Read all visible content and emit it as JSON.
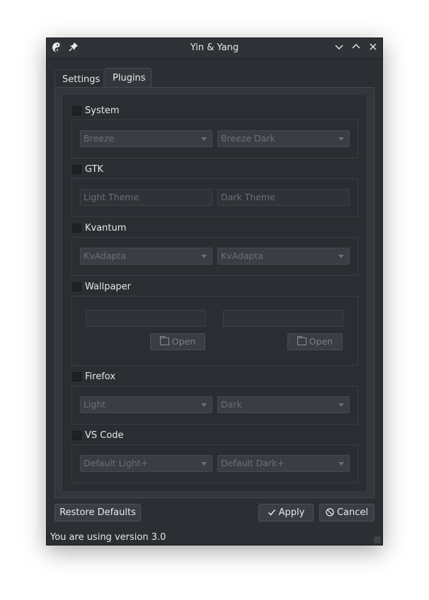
{
  "window": {
    "title": "Yin & Yang"
  },
  "titlebar_icons": {
    "app": "yin-yang-icon",
    "pin": "pin-icon",
    "minimize": "chevron-down-icon",
    "maximize": "chevron-up-icon",
    "close": "close-icon"
  },
  "tabs": [
    {
      "label": "Settings"
    },
    {
      "label": "Plugins"
    }
  ],
  "plugins": {
    "system": {
      "label": "System",
      "light": "Breeze",
      "dark": "Breeze Dark"
    },
    "gtk": {
      "label": "GTK",
      "light_placeholder": "Light Theme",
      "dark_placeholder": "Dark Theme"
    },
    "kvantum": {
      "label": "Kvantum",
      "light": "KvAdapta",
      "dark": "KvAdapta"
    },
    "wallpaper": {
      "label": "Wallpaper",
      "light_value": "",
      "dark_value": "",
      "open_label": "Open"
    },
    "firefox": {
      "label": "Firefox",
      "light": "Light",
      "dark": "Dark"
    },
    "vscode": {
      "label": "VS Code",
      "light": "Default Light+",
      "dark": "Default Dark+"
    }
  },
  "buttons": {
    "restore": "Restore Defaults",
    "apply": "Apply",
    "cancel": "Cancel"
  },
  "status": "You are using version 3.0"
}
